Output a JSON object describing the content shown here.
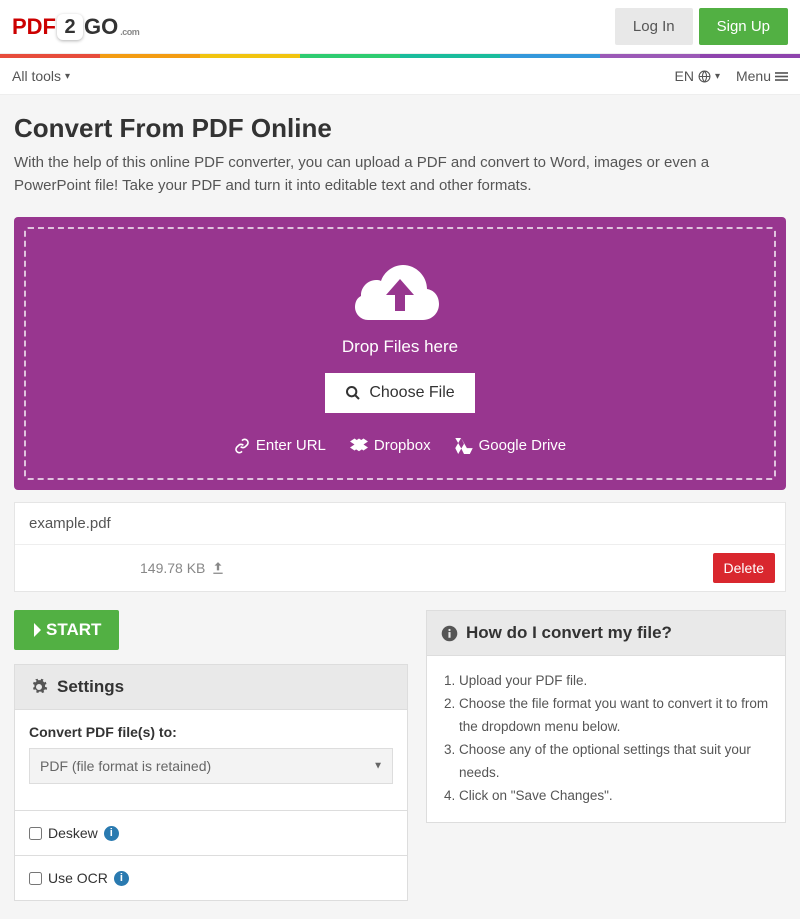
{
  "header": {
    "logo": {
      "pdf": "PDF",
      "two": "2",
      "go": "GO",
      "com": ".com"
    },
    "login": "Log In",
    "signup": "Sign Up"
  },
  "subnav": {
    "all_tools": "All tools",
    "lang": "EN",
    "menu": "Menu"
  },
  "page": {
    "title": "Convert From PDF Online",
    "subtitle": "With the help of this online PDF converter, you can upload a PDF and convert to Word, images or even a PowerPoint file! Take your PDF and turn it into editable text and other formats."
  },
  "dropzone": {
    "drop_text": "Drop Files here",
    "choose": "Choose File",
    "url": "Enter URL",
    "dropbox": "Dropbox",
    "gdrive": "Google Drive"
  },
  "file": {
    "name": "example.pdf",
    "size": "149.78 KB",
    "delete": "Delete"
  },
  "start_label": "START",
  "settings": {
    "heading": "Settings",
    "convert_label": "Convert PDF file(s) to:",
    "format_selected": "PDF (file format is retained)",
    "deskew": "Deskew",
    "ocr": "Use OCR"
  },
  "help": {
    "heading": "How do I convert my file?",
    "steps": [
      "Upload your PDF file.",
      "Choose the file format you want to convert it to from the dropdown menu below.",
      "Choose any of the optional settings that suit your needs.",
      "Click on \"Save Changes\"."
    ]
  }
}
